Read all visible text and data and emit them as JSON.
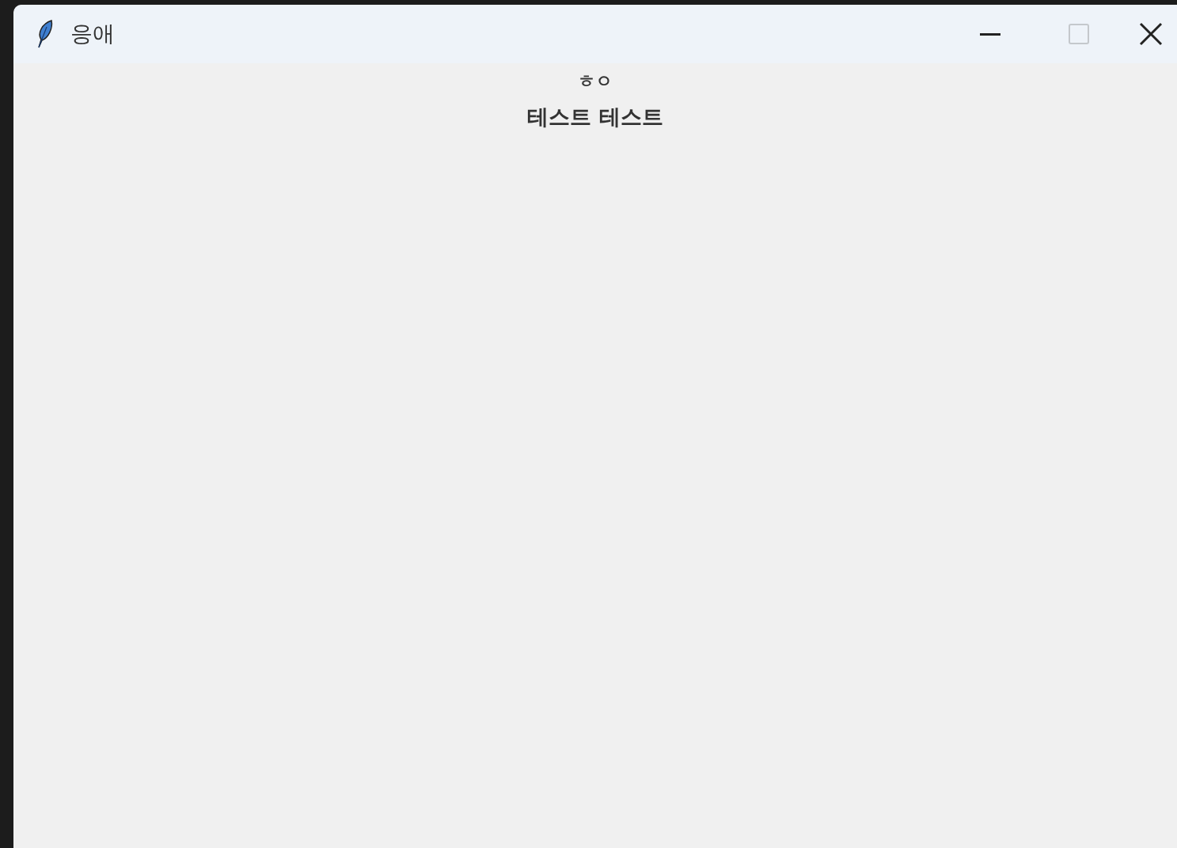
{
  "window": {
    "title": "응애",
    "controls": [
      {
        "kind": "minimize",
        "disabled": false
      },
      {
        "kind": "maximize",
        "disabled": true
      },
      {
        "kind": "close",
        "disabled": false
      }
    ]
  },
  "labels": [
    "ㅎㅇ",
    "테스트 테스트"
  ]
}
